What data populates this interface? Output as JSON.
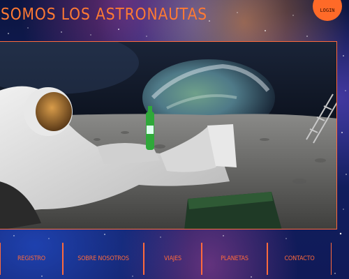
{
  "header": {
    "site_title": "SOMOS LOS ASTRONAUTAS",
    "login_label": "LOGIN"
  },
  "colors": {
    "accent": "#ff6a3c",
    "login_bg": "#ff6a28"
  },
  "nav": {
    "items": [
      {
        "label": "Registro"
      },
      {
        "label": "Sobre nosotros"
      },
      {
        "label": "Viajes"
      },
      {
        "label": "Planetas"
      },
      {
        "label": "Contacto"
      }
    ]
  }
}
